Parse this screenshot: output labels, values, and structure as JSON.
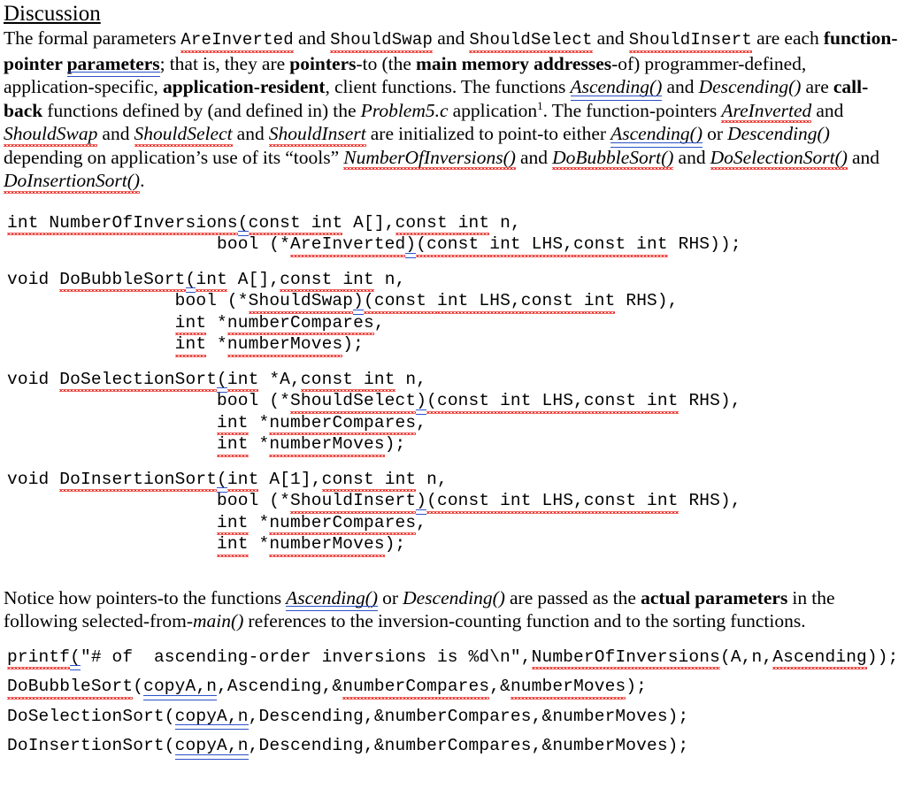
{
  "document": {
    "heading": "Discussion",
    "footnote_marker": "1",
    "colors": {
      "spellcheck_underline": "#e8302a",
      "grammar_underline": "#2b50c8",
      "text": "#000000",
      "background": "#ffffff"
    },
    "paragraph1": {
      "t1": "The formal parameters ",
      "code_AreInverted": "AreInverted",
      "t2": " and ",
      "code_ShouldSwap": "ShouldSwap",
      "t3": " and ",
      "code_ShouldSelect": "ShouldSelect",
      "t4": " and ",
      "code_ShouldInsert": "ShouldInsert",
      "t5": " are each ",
      "b_function_pointer": "function-pointer ",
      "b_parameters": "parameters",
      "t6": "; that is, they are ",
      "b_pointers": "pointers",
      "t7": "-to (the ",
      "b_main_memory_addresses": "main memory addresses",
      "t8": "-of) programmer-defined, application-specific, ",
      "b_application_resident": "application-resident",
      "t9": ", client functions. The functions ",
      "i_Ascending": "Ascending()",
      "t10": " and ",
      "i_Descending": "Descending()",
      "t11": " are ",
      "b_callback": "call-back",
      "t12": " functions defined by (and defined in) the ",
      "i_Problem5c": "Problem5.c",
      "t13": " application",
      "t14": ". The function-pointers ",
      "i_AreInverted": "AreInverted",
      "t15": " and ",
      "i_ShouldSwap": "ShouldSwap",
      "t16": " and ",
      "i_ShouldSelect": "ShouldSelect",
      "t17": " and ",
      "i_ShouldInsert": "ShouldInsert",
      "t18": " are initialized to point-to either ",
      "i_Ascending2": "Ascending()",
      "t19": " or ",
      "i_Descending2": "Descending()",
      "t20": " depending on application’s use of its “tools” ",
      "i_NumberOfInversions": "NumberOfInversions()",
      "t21": " and ",
      "i_DoBubbleSort": "DoBubbleSort()",
      "t22": " and ",
      "i_DoSelectionSort": "DoSelectionSort()",
      "t23": " and ",
      "i_DoInsertionSort": "DoInsertionSort()",
      "t24": "."
    },
    "code_block_1": {
      "l1_a": "int ",
      "l1_b": "NumberOfInversions",
      "l1_c": "(",
      "l1_d": "const ",
      "l1_e": "int",
      "l1_f": " A[],",
      "l1_g": "const ",
      "l1_h": "int",
      "l1_i": " n,",
      "l2_indent": "                    ",
      "l2_a": "bool (*",
      "l2_b": "AreInverted",
      "l2_c": ")",
      "l2_d": "(const ",
      "l2_e": "int",
      "l2_f": " LHS,",
      "l2_g": "const ",
      "l2_h": "int",
      "l2_i": " RHS));"
    },
    "code_block_2": {
      "l1_a": "void ",
      "l1_b": "DoBubbleSort",
      "l1_c": "(",
      "l1_d": "int",
      "l1_e": " A[],",
      "l1_f": "const ",
      "l1_g": "int",
      "l1_h": " n,",
      "l2_indent": "                ",
      "l2_a": "bool (*",
      "l2_b": "ShouldSwap",
      "l2_c": ")",
      "l2_d": "(const ",
      "l2_e": "int",
      "l2_f": " LHS,",
      "l2_g": "const ",
      "l2_h": "int",
      "l2_i": " RHS),",
      "l3_indent": "                ",
      "l3_a": "int",
      "l3_b": " *",
      "l3_c": "numberCompares",
      "l3_d": ",",
      "l4_indent": "                ",
      "l4_a": "int",
      "l4_b": " *",
      "l4_c": "numberMoves",
      "l4_d": ");"
    },
    "code_block_3": {
      "l1_a": "void ",
      "l1_b": "DoSelectionSort",
      "l1_c": "(",
      "l1_d": "int",
      "l1_e": " *A,",
      "l1_f": "const ",
      "l1_g": "int",
      "l1_h": " n,",
      "l2_indent": "                    ",
      "l2_a": "bool (*",
      "l2_b": "ShouldSelect",
      "l2_c": ")",
      "l2_d": "(const ",
      "l2_e": "int",
      "l2_f": " LHS,",
      "l2_g": "const ",
      "l2_h": "int",
      "l2_i": " RHS),",
      "l3_indent": "                    ",
      "l3_a": "int",
      "l3_b": " *",
      "l3_c": "numberCompares",
      "l3_d": ",",
      "l4_indent": "                    ",
      "l4_a": "int",
      "l4_b": " *",
      "l4_c": "numberMoves",
      "l4_d": ");"
    },
    "code_block_4": {
      "l1_a": "void ",
      "l1_b": "DoInsertionSort",
      "l1_c": "(",
      "l1_d": "int",
      "l1_e": " A[1],",
      "l1_f": "const ",
      "l1_g": "int",
      "l1_h": " n,",
      "l2_indent": "                    ",
      "l2_a": "bool (*",
      "l2_b": "ShouldInsert",
      "l2_c": ")",
      "l2_d": "(const ",
      "l2_e": "int",
      "l2_f": " LHS,",
      "l2_g": "const ",
      "l2_h": "int",
      "l2_i": " RHS),",
      "l3_indent": "                    ",
      "l3_a": "int",
      "l3_b": " *",
      "l3_c": "numberCompares",
      "l3_d": ",",
      "l4_indent": "                    ",
      "l4_a": "int",
      "l4_b": " *",
      "l4_c": "numberMoves",
      "l4_d": ");"
    },
    "paragraph2": {
      "t1": "Notice how pointers-to the functions ",
      "i_Ascending": "Ascending()",
      "t2": " or ",
      "i_Descending": "Descending()",
      "t3": " are passed as the ",
      "b_actual_parameters": "actual parameters",
      "t4": " in the following selected-from-",
      "i_main": "main()",
      "t5": " references to the inversion-counting function and to the sorting functions."
    },
    "code_call_1": {
      "a": "printf",
      "b": "(",
      "c": "\"# of  ascending-order inversions is %d\\n\",",
      "d": "NumberOfInversions",
      "e": "(A,n,",
      "f": "Ascending",
      "g": "));"
    },
    "code_call_2": {
      "a": "DoBubbleSort",
      "b": "(",
      "c": "copyA,n",
      "d": ",Ascending,&",
      "e": "numberCompares",
      "f": ",&",
      "g": "numberMoves",
      "h": ");"
    },
    "code_call_3": {
      "a": "DoSelectionSort",
      "b": "(",
      "c": "copyA,n",
      "d": ",Descending,&numberCompares,&numberMoves);"
    },
    "code_call_4": {
      "a": "DoInsertionSort",
      "b": "(",
      "c": "copyA,n",
      "d": ",Descending,&numberCompares,&numberMoves);"
    }
  }
}
